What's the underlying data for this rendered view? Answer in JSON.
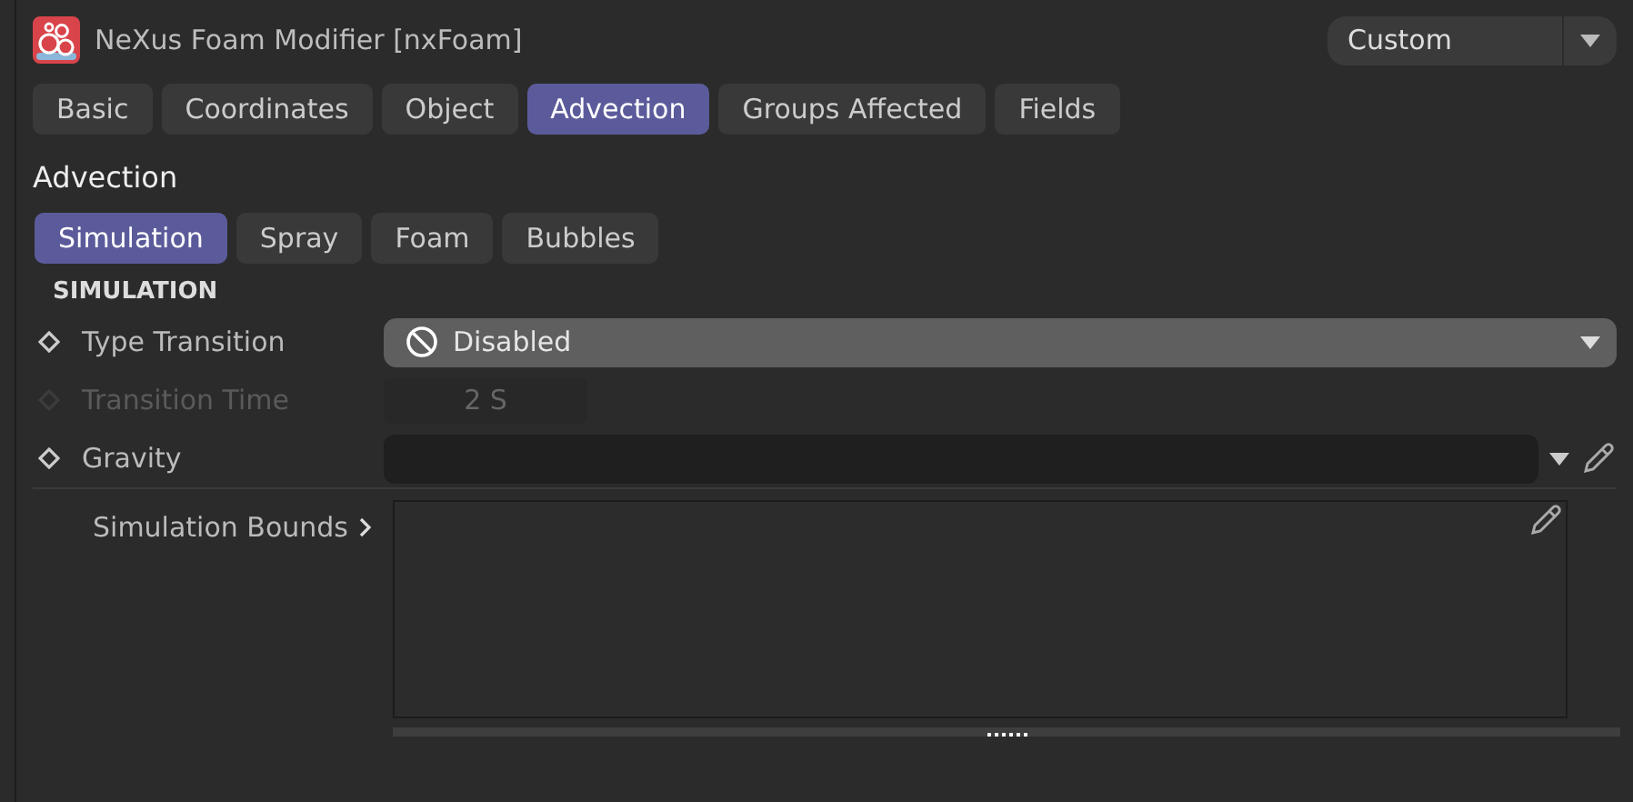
{
  "header": {
    "title": "NeXus Foam Modifier [nxFoam]",
    "preset": "Custom"
  },
  "tabs": [
    {
      "label": "Basic",
      "selected": false
    },
    {
      "label": "Coordinates",
      "selected": false
    },
    {
      "label": "Object",
      "selected": false
    },
    {
      "label": "Advection",
      "selected": true
    },
    {
      "label": "Groups Affected",
      "selected": false
    },
    {
      "label": "Fields",
      "selected": false
    }
  ],
  "section_title": "Advection",
  "subtabs": [
    {
      "label": "Simulation",
      "selected": true
    },
    {
      "label": "Spray",
      "selected": false
    },
    {
      "label": "Foam",
      "selected": false
    },
    {
      "label": "Bubbles",
      "selected": false
    }
  ],
  "group_title": "SIMULATION",
  "params": [
    {
      "kind": "dropdown",
      "label": "Type Transition",
      "value": "Disabled",
      "disabled": false
    },
    {
      "kind": "number",
      "label": "Transition Time",
      "value": "2 S",
      "disabled": true
    },
    {
      "kind": "link",
      "label": "Gravity",
      "disabled": false
    },
    {
      "kind": "list",
      "label": "Simulation Bounds",
      "disabled": false
    }
  ]
}
